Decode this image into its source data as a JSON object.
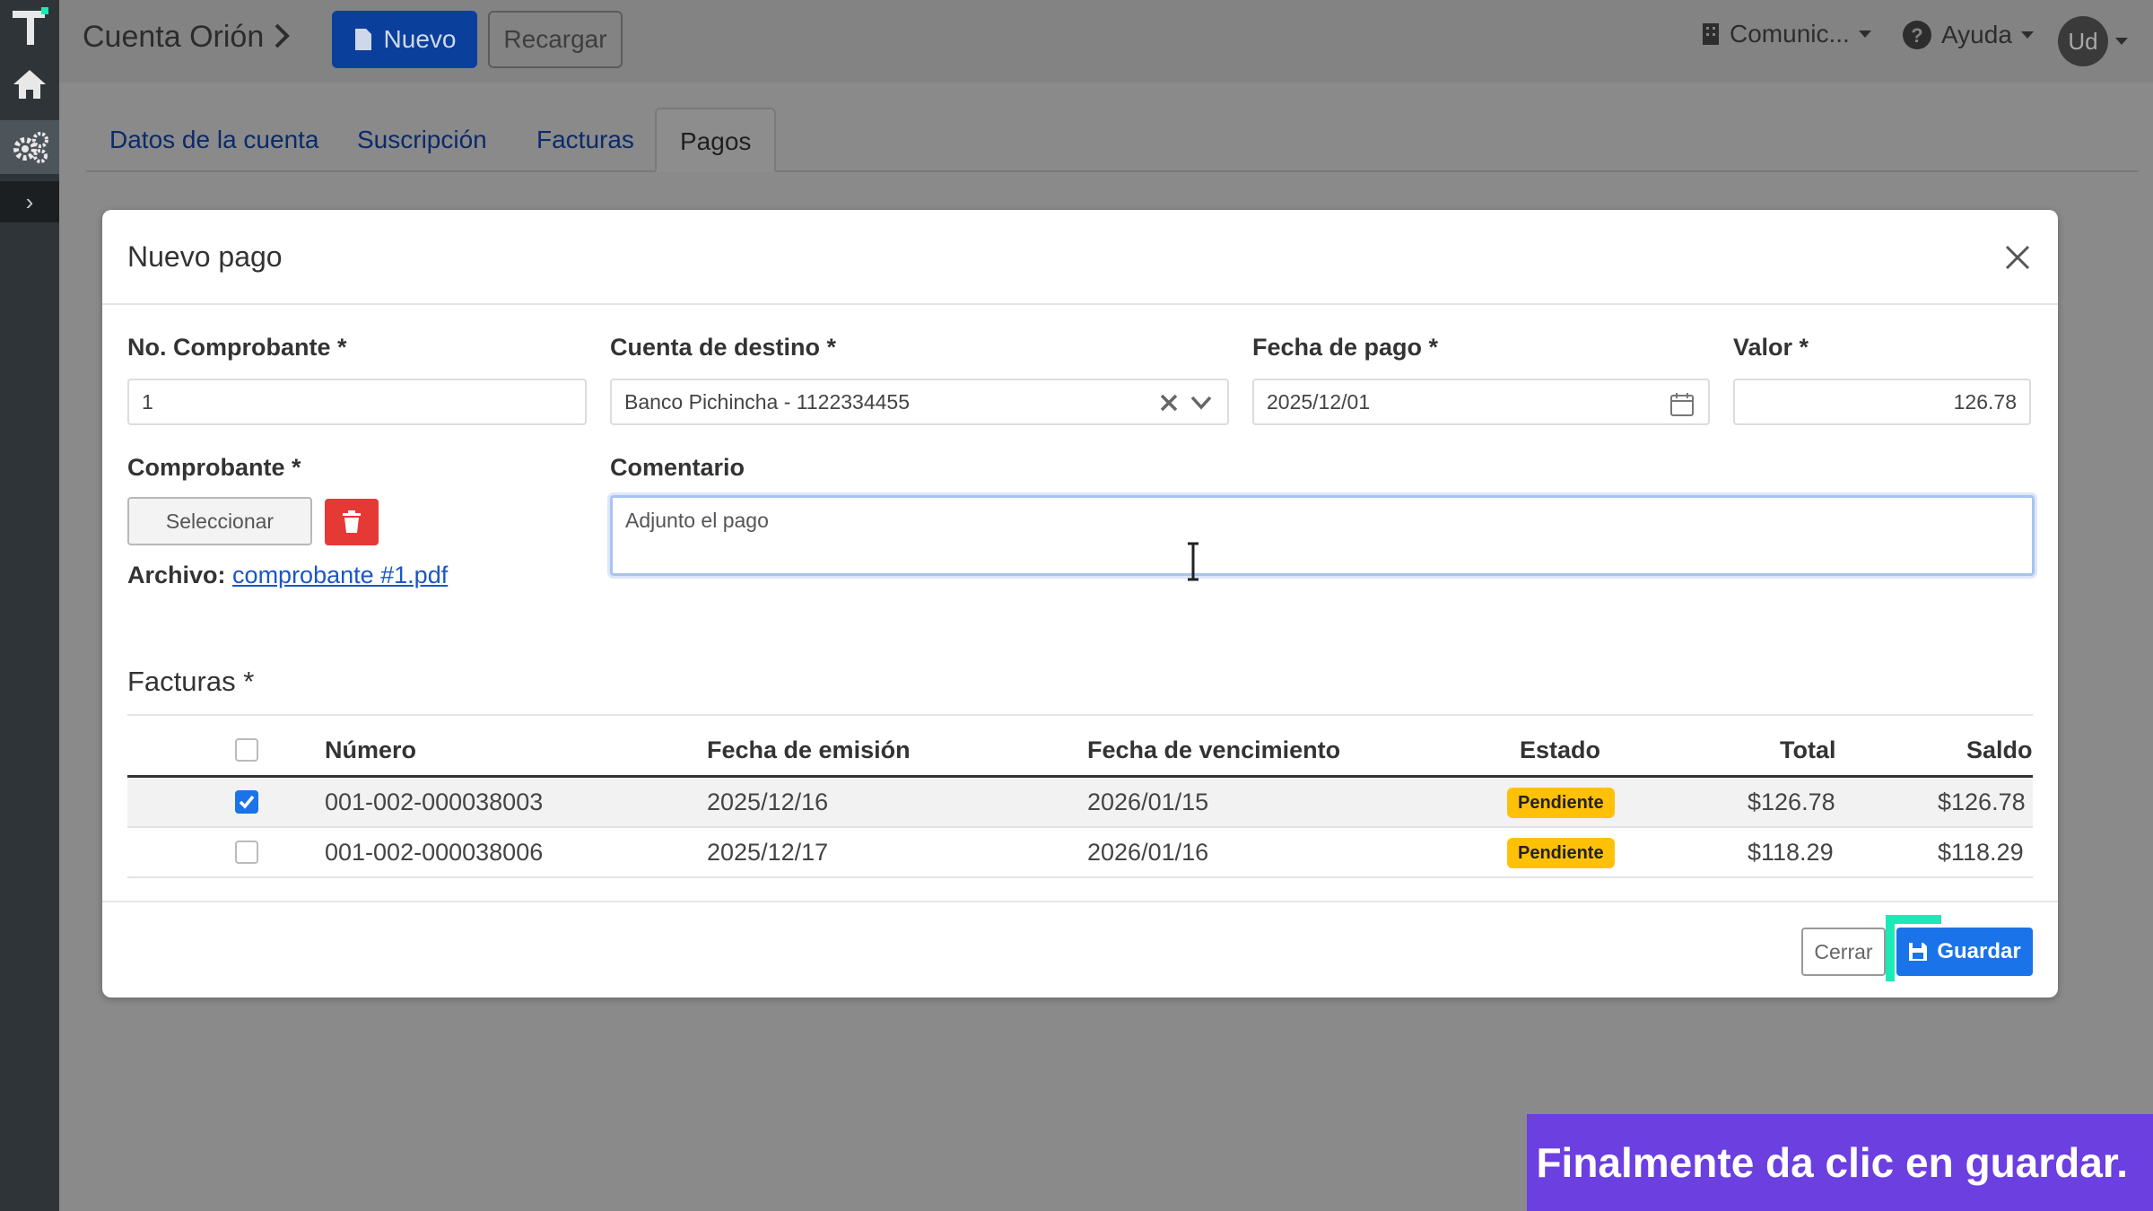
{
  "header": {
    "account_title": "Cuenta Orión",
    "new_button": "Nuevo",
    "reload_button": "Recargar",
    "company_menu": "Comunic...",
    "help_menu": "Ayuda",
    "user_initials": "Ud"
  },
  "tabs": [
    {
      "label": "Datos de la cuenta"
    },
    {
      "label": "Suscripción"
    },
    {
      "label": "Facturas"
    },
    {
      "label": "Pagos",
      "active": true
    }
  ],
  "modal": {
    "title": "Nuevo pago",
    "fields": {
      "receipt_no_label": "No. Comprobante *",
      "receipt_no_value": "1",
      "destination_label": "Cuenta de destino *",
      "destination_value": "Banco Pichincha - 1122334455",
      "payment_date_label": "Fecha de pago *",
      "payment_date_value": "2025/12/01",
      "amount_label": "Valor *",
      "amount_value": "126.78",
      "receipt_label": "Comprobante *",
      "select_button": "Seleccionar",
      "file_label": "Archivo:",
      "file_name": "comprobante #1.pdf",
      "comment_label": "Comentario",
      "comment_value": "Adjunto el pago"
    },
    "invoices": {
      "title": "Facturas *",
      "columns": [
        "Número",
        "Fecha de emisión",
        "Fecha de vencimiento",
        "Estado",
        "Total",
        "Saldo"
      ],
      "rows": [
        {
          "checked": true,
          "numero": "001-002-000038003",
          "emision": "2025/12/16",
          "vencimiento": "2026/01/15",
          "estado": "Pendiente",
          "total": "$126.78",
          "saldo": "$126.78"
        },
        {
          "checked": false,
          "numero": "001-002-000038006",
          "emision": "2025/12/17",
          "vencimiento": "2026/01/16",
          "estado": "Pendiente",
          "total": "$118.29",
          "saldo": "$118.29"
        }
      ]
    },
    "close_button": "Cerrar",
    "save_button": "Guardar"
  },
  "caption": "Finalmente da clic en guardar.",
  "colors": {
    "primary": "#1a73e8",
    "danger": "#e53935",
    "warning": "#ffc107",
    "highlight": "#1de9b6",
    "caption_bg": "#6b3fe0",
    "sidebar": "#2f3438"
  }
}
